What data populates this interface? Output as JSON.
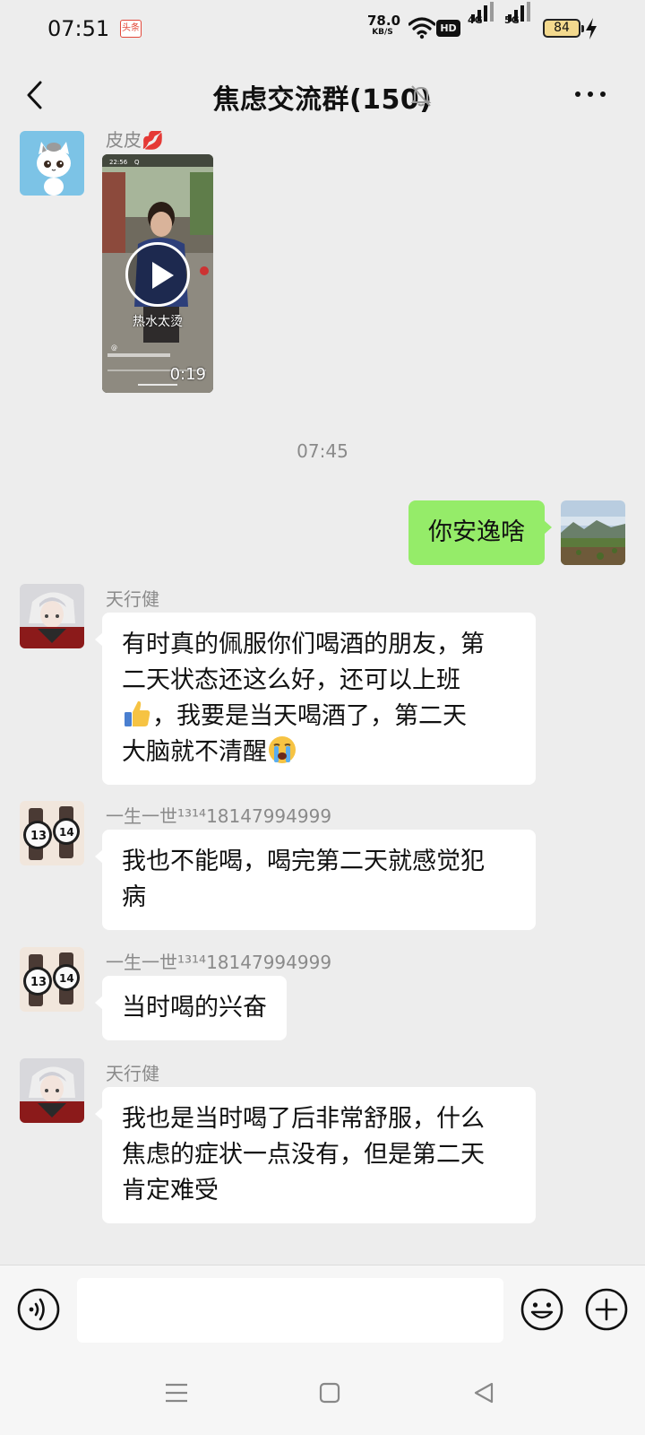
{
  "status_bar": {
    "time": "07:51",
    "app_badge": "头条",
    "net_speed_value": "78.0",
    "net_speed_unit": "KB/S",
    "hd_label": "HD",
    "signal_1_label": "4G",
    "signal_2_label": "5G",
    "battery": "84"
  },
  "header": {
    "title": "焦虑交流群(150)"
  },
  "messages": [
    {
      "sender": "皮皮💋",
      "type": "video",
      "caption": "热水太烫",
      "duration": "0:19"
    },
    {
      "type": "timestamp",
      "text": "07:45"
    },
    {
      "type": "outgoing",
      "text": "你安逸啥"
    },
    {
      "sender": "天行健",
      "type": "text",
      "lines": [
        "有时真的佩服你们喝酒的朋友，第",
        "二天状态还这么好，还可以上班",
        "，我要是当天喝酒了，第二天",
        "大脑就不清醒"
      ]
    },
    {
      "sender": "一生一世¹³¹⁴18147994999",
      "type": "text",
      "lines": [
        "我也不能喝，喝完第二天就感觉犯",
        "病"
      ]
    },
    {
      "sender": "一生一世¹³¹⁴18147994999",
      "type": "text",
      "lines": [
        "当时喝的兴奋"
      ]
    },
    {
      "sender": "天行健",
      "type": "text",
      "lines": [
        "我也是当时喝了后非常舒服，什么",
        "焦虑的症状一点没有，但是第二天",
        "肯定难受"
      ]
    }
  ],
  "input_bar": {
    "value": ""
  },
  "colors": {
    "background": "#ededed",
    "outgoing_bubble": "#95ec69",
    "incoming_bubble": "#ffffff"
  },
  "icons": [
    "back-icon",
    "mute-bell-icon",
    "more-icon",
    "voice-icon",
    "emoji-icon",
    "plus-icon",
    "menu-icon",
    "home-icon",
    "back-triangle-icon"
  ]
}
